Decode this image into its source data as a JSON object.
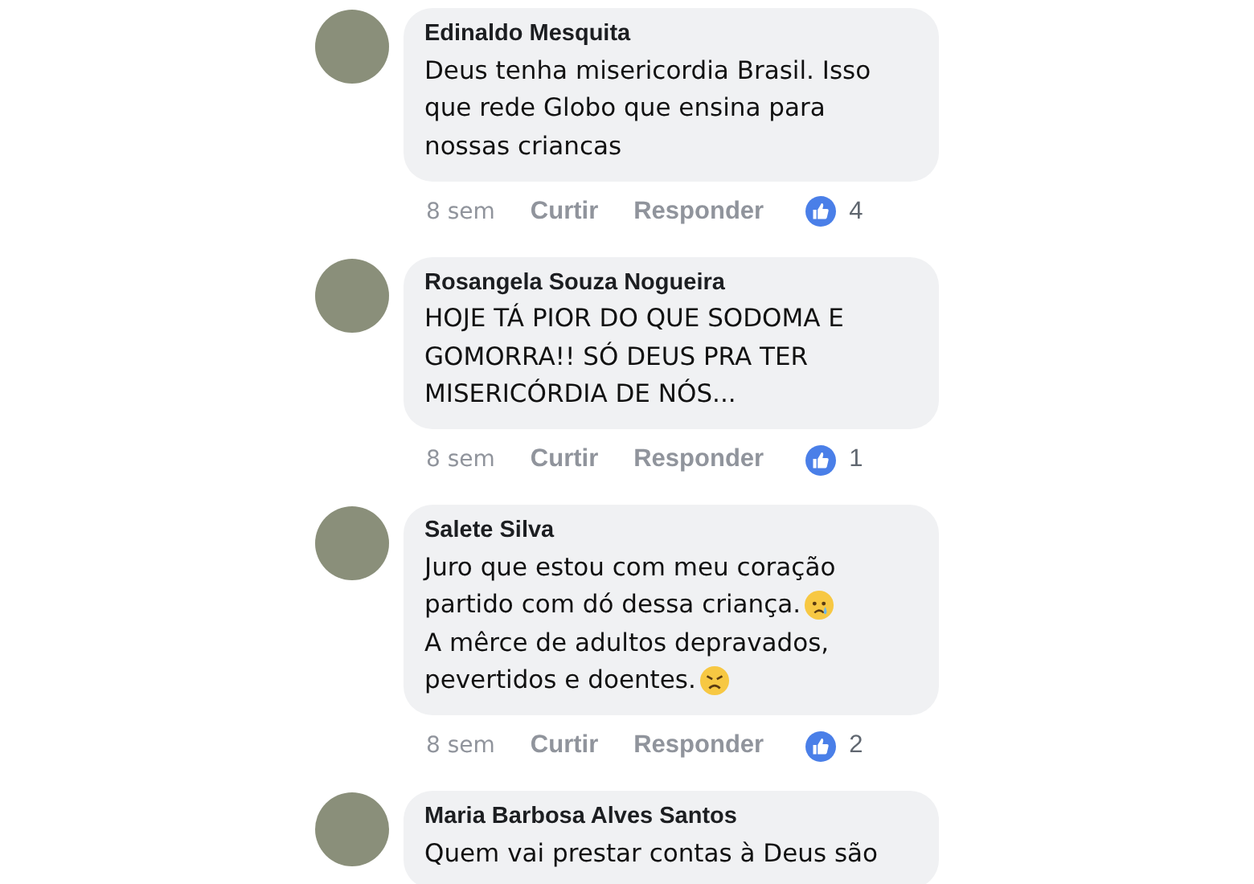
{
  "comments": [
    {
      "author": "Edinaldo Mesquita",
      "lines": [
        {
          "text": "Deus tenha misericordia Brasil. Isso"
        },
        {
          "text": "que rede Globo que ensina para"
        },
        {
          "text": "nossas criancas"
        }
      ],
      "time": "8 sem",
      "like_label": "Curtir",
      "reply_label": "Responder",
      "likes": "4"
    },
    {
      "author": "Rosangela Souza Nogueira",
      "lines": [
        {
          "text": "HOJE TÁ PIOR DO QUE SODOMA E"
        },
        {
          "text": "GOMORRA!! SÓ DEUS PRA TER"
        },
        {
          "text": "MISERICÓRDIA DE NÓS..."
        }
      ],
      "time": "8 sem",
      "like_label": "Curtir",
      "reply_label": "Responder",
      "likes": "1"
    },
    {
      "author": "Salete Silva",
      "lines": [
        {
          "text": "Juro que estou com meu coração"
        },
        {
          "text": "partido com dó dessa criança.",
          "kind": "teary"
        },
        {
          "text": "A mêrce de adultos depravados,"
        },
        {
          "text": "pevertidos e doentes.",
          "kind": "frowning"
        }
      ],
      "time": "8 sem",
      "like_label": "Curtir",
      "reply_label": "Responder",
      "likes": "2"
    },
    {
      "author": "Maria Barbosa Alves Santos",
      "lines": [
        {
          "text": "Quem vai prestar contas à Deus são"
        }
      ]
    }
  ]
}
